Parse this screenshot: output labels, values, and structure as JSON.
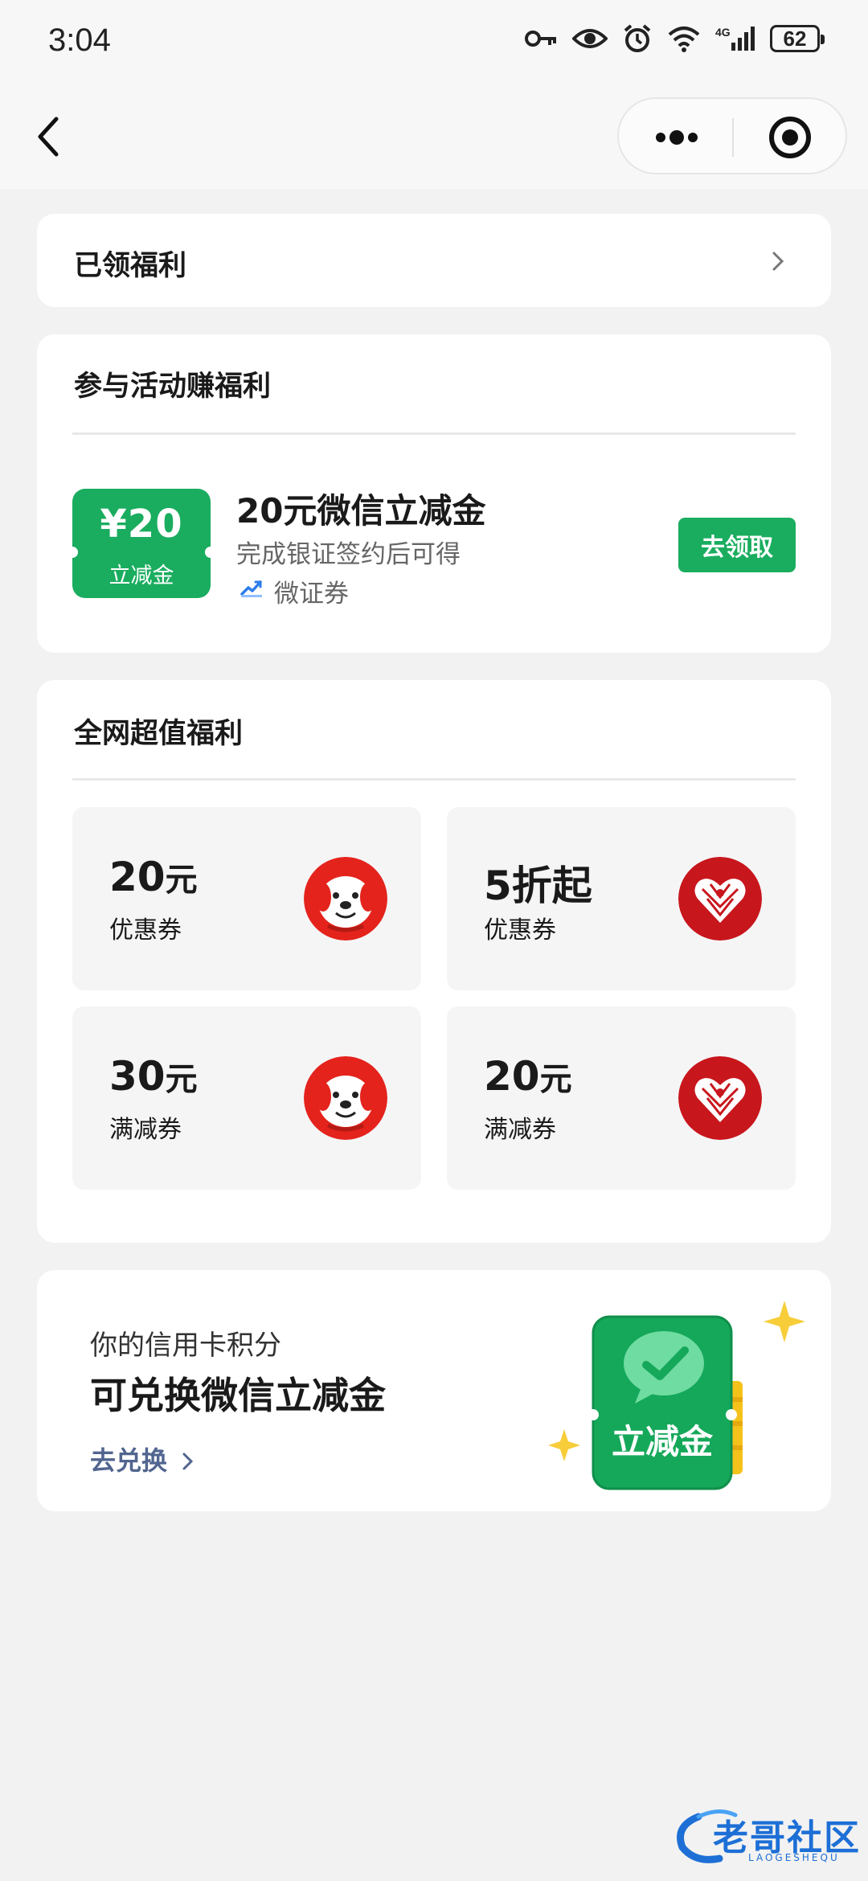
{
  "status": {
    "time": "3:04",
    "battery": "62",
    "network": "4G"
  },
  "nav": {
    "back": "back-arrow-icon",
    "more": "more-dots-icon",
    "close": "target-close-icon"
  },
  "claimed": {
    "title": "已领福利"
  },
  "activity": {
    "title": "参与活动赚福利",
    "voucher_amount": "¥20",
    "voucher_label": "立减金",
    "item_title": "20元微信立减金",
    "item_desc": "完成银证签约后可得",
    "item_source": "微证券",
    "button": "去领取"
  },
  "deals": {
    "title": "全网超值福利",
    "tiles": [
      {
        "value": "20",
        "unit": "元",
        "label": "优惠券",
        "brand": "jd"
      },
      {
        "value": "5折起",
        "unit": "",
        "label": "优惠券",
        "brand": "pdd"
      },
      {
        "value": "30",
        "unit": "元",
        "label": "满减券",
        "brand": "jd"
      },
      {
        "value": "20",
        "unit": "元",
        "label": "满减券",
        "brand": "pdd"
      }
    ]
  },
  "promo": {
    "subtitle": "你的信用卡积分",
    "title": "可兑换微信立减金",
    "link": "去兑换",
    "art_text": "立减金"
  },
  "watermark": {
    "text": "老哥社区",
    "sub": "LAOGESHEQU"
  },
  "colors": {
    "green": "#1aad5f",
    "jd_red": "#e4231c",
    "pdd_red": "#c8161d",
    "link": "#51658f"
  }
}
